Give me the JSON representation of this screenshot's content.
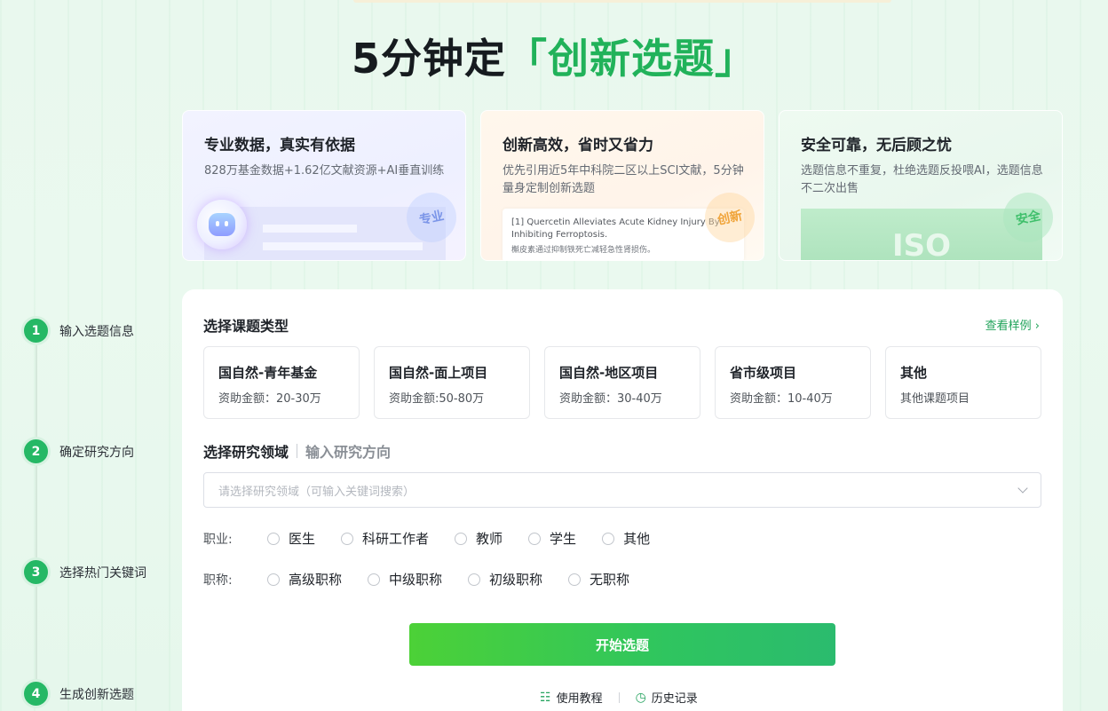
{
  "headline": {
    "main": "5分钟定",
    "highlight": "「创新选题」"
  },
  "features": [
    {
      "title": "专业数据，真实有依据",
      "desc": "828万基金数据+1.62亿文献资源+AI垂直训练",
      "badge": "专业"
    },
    {
      "title": "创新高效，省时又省力",
      "desc": "优先引用近5年中科院二区以上SCI文献，5分钟量身定制创新选题",
      "badge": "创新",
      "doc_en": "[1] Quercetin Alleviates Acute Kidney Injury By Inhibiting Ferroptosis.",
      "doc_cn": "槲皮素通过抑制铁死亡减轻急性肾损伤。"
    },
    {
      "title": "安全可靠，无后顾之忧",
      "desc": "选题信息不重复，杜绝选题反投喂AI，选题信息不二次出售",
      "badge": "安全",
      "cert": "ISO"
    }
  ],
  "steps": [
    {
      "num": "1",
      "label": "输入选题信息"
    },
    {
      "num": "2",
      "label": "确定研究方向"
    },
    {
      "num": "3",
      "label": "选择热门关键词"
    },
    {
      "num": "4",
      "label": "生成创新选题"
    }
  ],
  "form": {
    "type_title": "选择课题类型",
    "view_example": "查看样例 ›",
    "types": [
      {
        "name": "国自然-青年基金",
        "amount": "资助金额：20-30万"
      },
      {
        "name": "国自然-面上项目",
        "amount": "资助金额:50-80万"
      },
      {
        "name": "国自然-地区项目",
        "amount": "资助金额：30-40万"
      },
      {
        "name": "省市级项目",
        "amount": "资助金额：10-40万"
      },
      {
        "name": "其他",
        "amount": "其他课题项目"
      }
    ],
    "tab_active": "选择研究领域",
    "tab_inactive": "输入研究方向",
    "field_placeholder": "请选择研究领域（可输入关键词搜索）",
    "occupation_label": "职业:",
    "occupations": [
      "医生",
      "科研工作者",
      "教师",
      "学生",
      "其他"
    ],
    "title_label": "职称:",
    "titles": [
      "高级职称",
      "中级职称",
      "初级职称",
      "无职称"
    ],
    "start_button": "开始选题",
    "tutorial_link": "使用教程",
    "history_link": "历史记录"
  },
  "colors": {
    "accent": "#25b865",
    "brand_green": "#21b25a"
  }
}
